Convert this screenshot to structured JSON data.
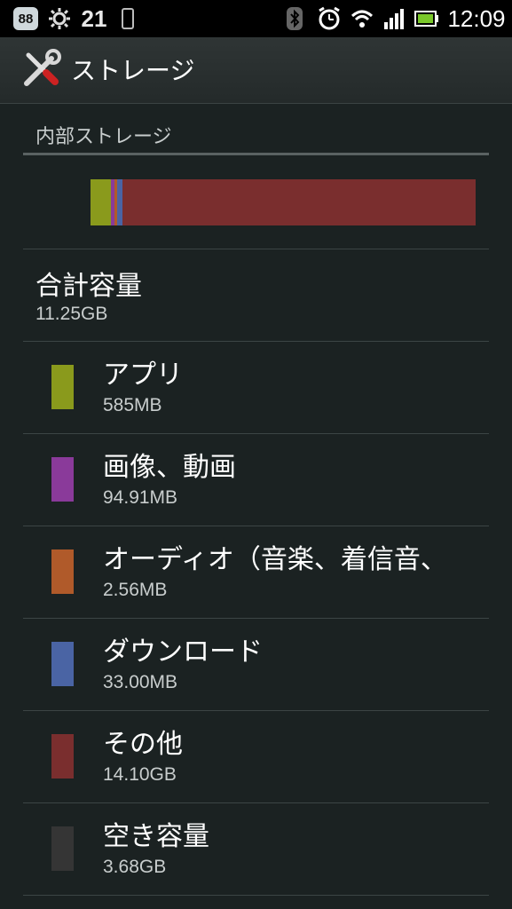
{
  "status_bar": {
    "badge": "88",
    "date": "21",
    "clock": "12:09",
    "icons": [
      "settings-gear-icon",
      "phone-icon",
      "bluetooth-icon",
      "alarm-icon",
      "wifi-icon",
      "signal-icon",
      "battery-icon"
    ]
  },
  "title_bar": {
    "title": "ストレージ",
    "icon": "tools-icon"
  },
  "section": {
    "header": "内部ストレージ"
  },
  "usage_bar": {
    "segments": [
      {
        "name": "アプリ",
        "fraction": 0.052,
        "color": "#8a9a1c"
      },
      {
        "name": "画像、動画",
        "fraction": 0.01,
        "color": "#8a3a9a"
      },
      {
        "name": "オーディオ",
        "fraction": 0.008,
        "color": "#b05a2a"
      },
      {
        "name": "ダウンロード",
        "fraction": 0.012,
        "color": "#4a64a4"
      },
      {
        "name": "その他",
        "fraction": 0.918,
        "color": "#7a2e2e"
      }
    ]
  },
  "total": {
    "label": "合計容量",
    "value": "11.25GB"
  },
  "categories": [
    {
      "label": "アプリ",
      "value": "585MB",
      "color": "#8a9a1c"
    },
    {
      "label": "画像、動画",
      "value": "94.91MB",
      "color": "#8a3a9a"
    },
    {
      "label": "オーディオ（音楽、着信音、",
      "value": "2.56MB",
      "color": "#b05a2a"
    },
    {
      "label": "ダウンロード",
      "value": "33.00MB",
      "color": "#4a64a4"
    },
    {
      "label": "その他",
      "value": "14.10GB",
      "color": "#7a2e2e"
    },
    {
      "label": "空き容量",
      "value": "3.68GB",
      "color": "#353535"
    }
  ]
}
